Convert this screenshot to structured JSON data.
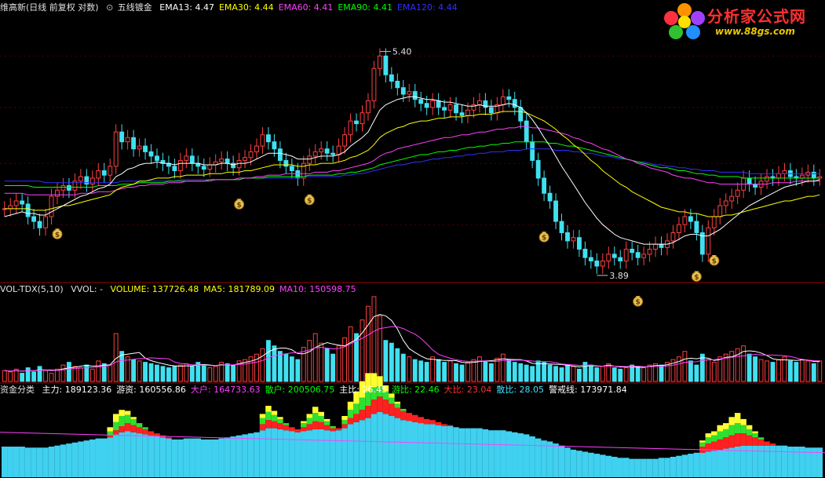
{
  "main_header": {
    "title": "维高新(日线 前复权 对数)",
    "indicator_name": "五线镀金",
    "items": [
      {
        "label": "EMA13: 4.47",
        "color": "#ffffff"
      },
      {
        "label": "EMA30: 4.44",
        "color": "#ffff00"
      },
      {
        "label": "EMA60: 4.41",
        "color": "#ff40ff"
      },
      {
        "label": "EMA90: 4.41",
        "color": "#00ff00"
      },
      {
        "label": "EMA120: 4.44",
        "color": "#3030ff"
      }
    ],
    "high_label": "5.40",
    "low_label": "3.89"
  },
  "volume_header": {
    "title": "VOL-TDX(5,10)",
    "vvol": "VVOL: -",
    "items": [
      {
        "label": "VOLUME: 137726.48",
        "color": "#ffff00"
      },
      {
        "label": "MA5: 181789.09",
        "color": "#ffff00"
      },
      {
        "label": "MA10: 150598.75",
        "color": "#ff40ff"
      }
    ]
  },
  "fund_header": {
    "title": "资金分类",
    "items": [
      {
        "label": "主力: 189123.36",
        "color": "#ffffff"
      },
      {
        "label": "游资: 160556.86",
        "color": "#ffffff"
      },
      {
        "label": "大户: 164733.63",
        "color": "#ff40ff"
      },
      {
        "label": "散户: 200506.75",
        "color": "#00ff00"
      },
      {
        "label": "主比: 26.45",
        "color": "#ffffff"
      },
      {
        "label": "游比: 22.46",
        "color": "#00ff00"
      },
      {
        "label": "大比: 23.04",
        "color": "#ff3030"
      },
      {
        "label": "散比: 28.05",
        "color": "#40e0ff"
      },
      {
        "label": "警戒线: 173971.84",
        "color": "#ffffff"
      }
    ]
  },
  "logo": {
    "title": "分析家公式网",
    "url": "www.88gs.com"
  },
  "chart_data": {
    "type": "candlestick",
    "ylim": [
      3.7,
      5.55
    ],
    "log_scale": true,
    "close": [
      4.1,
      4.12,
      4.15,
      4.13,
      4.05,
      4.02,
      3.98,
      4.05,
      4.18,
      4.22,
      4.25,
      4.22,
      4.28,
      4.31,
      4.26,
      4.3,
      4.35,
      4.32,
      4.38,
      4.62,
      4.55,
      4.58,
      4.5,
      4.52,
      4.48,
      4.45,
      4.42,
      4.4,
      4.38,
      4.35,
      4.42,
      4.45,
      4.4,
      4.38,
      4.36,
      4.39,
      4.41,
      4.43,
      4.4,
      4.37,
      4.42,
      4.44,
      4.48,
      4.52,
      4.6,
      4.55,
      4.5,
      4.42,
      4.38,
      4.35,
      4.3,
      4.4,
      4.45,
      4.48,
      4.5,
      4.47,
      4.46,
      4.52,
      4.6,
      4.7,
      4.68,
      4.76,
      4.85,
      5.1,
      5.2,
      5.05,
      5.0,
      4.95,
      4.9,
      4.92,
      4.86,
      4.83,
      4.8,
      4.85,
      4.8,
      4.78,
      4.82,
      4.76,
      4.74,
      4.78,
      4.82,
      4.85,
      4.8,
      4.76,
      4.82,
      4.88,
      4.86,
      4.8,
      4.7,
      4.55,
      4.42,
      4.3,
      4.2,
      4.15,
      4.02,
      3.95,
      3.9,
      3.92,
      3.85,
      3.8,
      3.78,
      3.75,
      3.78,
      3.82,
      3.8,
      3.78,
      3.85,
      3.83,
      3.8,
      3.82,
      3.85,
      3.88,
      3.86,
      3.9,
      3.95,
      4.0,
      4.05,
      4.02,
      3.95,
      3.82,
      3.98,
      4.05,
      4.12,
      4.15,
      4.18,
      4.22,
      4.3,
      4.26,
      4.24,
      4.28,
      4.31,
      4.3,
      4.33,
      4.35,
      4.31,
      4.3,
      4.32,
      4.34,
      4.3,
      4.31
    ],
    "ema13": [
      4.05,
      4.06,
      4.07,
      4.08,
      4.07,
      4.07,
      4.06,
      4.06,
      4.08,
      4.1,
      4.12,
      4.14,
      4.16,
      4.18,
      4.19,
      4.21,
      4.23,
      4.24,
      4.26,
      4.31,
      4.33,
      4.36,
      4.37,
      4.39,
      4.4,
      4.4,
      4.41,
      4.4,
      4.4,
      4.39,
      4.4,
      4.4,
      4.4,
      4.4,
      4.39,
      4.39,
      4.39,
      4.4,
      4.4,
      4.39,
      4.4,
      4.4,
      4.41,
      4.43,
      4.45,
      4.47,
      4.47,
      4.47,
      4.46,
      4.45,
      4.43,
      4.43,
      4.43,
      4.44,
      4.45,
      4.45,
      4.45,
      4.46,
      4.48,
      4.52,
      4.55,
      4.58,
      4.62,
      4.7,
      4.78,
      4.82,
      4.84,
      4.86,
      4.87,
      4.88,
      4.88,
      4.87,
      4.86,
      4.86,
      4.85,
      4.84,
      4.84,
      4.83,
      4.82,
      4.81,
      4.81,
      4.82,
      4.81,
      4.81,
      4.81,
      4.82,
      4.83,
      4.82,
      4.8,
      4.76,
      4.71,
      4.65,
      4.58,
      4.52,
      4.45,
      4.38,
      4.32,
      4.26,
      4.2,
      4.14,
      4.09,
      4.04,
      4.0,
      3.97,
      3.94,
      3.92,
      3.91,
      3.9,
      3.89,
      3.88,
      3.88,
      3.88,
      3.88,
      3.88,
      3.89,
      3.91,
      3.93,
      3.94,
      3.94,
      3.93,
      3.93,
      3.95,
      3.97,
      4.0,
      4.03,
      4.06,
      4.09,
      4.12,
      4.14,
      4.16,
      4.18,
      4.2,
      4.22,
      4.24,
      4.25,
      4.26,
      4.27,
      4.28,
      4.28,
      4.29
    ],
    "ema30": [
      4.1,
      4.1,
      4.1,
      4.1,
      4.1,
      4.09,
      4.09,
      4.09,
      4.1,
      4.11,
      4.12,
      4.12,
      4.13,
      4.14,
      4.15,
      4.16,
      4.17,
      4.18,
      4.19,
      4.22,
      4.24,
      4.25,
      4.26,
      4.28,
      4.28,
      4.29,
      4.3,
      4.3,
      4.3,
      4.31,
      4.31,
      4.32,
      4.32,
      4.32,
      4.32,
      4.33,
      4.33,
      4.33,
      4.34,
      4.34,
      4.34,
      4.35,
      4.35,
      4.36,
      4.37,
      4.38,
      4.39,
      4.39,
      4.39,
      4.39,
      4.38,
      4.38,
      4.39,
      4.39,
      4.4,
      4.4,
      4.4,
      4.41,
      4.42,
      4.44,
      4.45,
      4.47,
      4.49,
      4.53,
      4.58,
      4.61,
      4.63,
      4.65,
      4.66,
      4.68,
      4.69,
      4.7,
      4.7,
      4.71,
      4.72,
      4.72,
      4.73,
      4.73,
      4.73,
      4.74,
      4.74,
      4.75,
      4.75,
      4.75,
      4.76,
      4.77,
      4.77,
      4.77,
      4.77,
      4.76,
      4.74,
      4.72,
      4.7,
      4.67,
      4.64,
      4.6,
      4.57,
      4.53,
      4.5,
      4.46,
      4.42,
      4.39,
      4.35,
      4.32,
      4.29,
      4.26,
      4.24,
      4.21,
      4.19,
      4.17,
      4.15,
      4.13,
      4.11,
      4.1,
      4.09,
      4.08,
      4.08,
      4.07,
      4.07,
      4.06,
      4.05,
      4.05,
      4.05,
      4.06,
      4.06,
      4.07,
      4.08,
      4.09,
      4.1,
      4.11,
      4.12,
      4.13,
      4.14,
      4.15,
      4.15,
      4.16,
      4.17,
      4.18,
      4.18,
      4.19
    ],
    "ema60": [
      4.2,
      4.2,
      4.2,
      4.2,
      4.19,
      4.19,
      4.19,
      4.19,
      4.19,
      4.19,
      4.19,
      4.19,
      4.19,
      4.2,
      4.2,
      4.2,
      4.21,
      4.21,
      4.21,
      4.22,
      4.23,
      4.24,
      4.24,
      4.25,
      4.25,
      4.26,
      4.26,
      4.26,
      4.27,
      4.27,
      4.27,
      4.28,
      4.28,
      4.28,
      4.28,
      4.28,
      4.29,
      4.29,
      4.29,
      4.29,
      4.3,
      4.3,
      4.3,
      4.31,
      4.31,
      4.32,
      4.32,
      4.32,
      4.33,
      4.33,
      4.33,
      4.33,
      4.33,
      4.34,
      4.34,
      4.34,
      4.35,
      4.35,
      4.36,
      4.37,
      4.38,
      4.39,
      4.4,
      4.42,
      4.45,
      4.47,
      4.48,
      4.5,
      4.51,
      4.52,
      4.53,
      4.54,
      4.55,
      4.56,
      4.57,
      4.58,
      4.58,
      4.59,
      4.6,
      4.6,
      4.61,
      4.62,
      4.62,
      4.63,
      4.64,
      4.64,
      4.65,
      4.65,
      4.66,
      4.66,
      4.65,
      4.65,
      4.64,
      4.63,
      4.62,
      4.61,
      4.6,
      4.58,
      4.57,
      4.55,
      4.54,
      4.52,
      4.5,
      4.49,
      4.47,
      4.45,
      4.43,
      4.42,
      4.4,
      4.39,
      4.37,
      4.36,
      4.35,
      4.34,
      4.32,
      4.31,
      4.3,
      4.3,
      4.29,
      4.28,
      4.27,
      4.27,
      4.26,
      4.26,
      4.26,
      4.26,
      4.26,
      4.26,
      4.26,
      4.26,
      4.26,
      4.27,
      4.27,
      4.27,
      4.27,
      4.28,
      4.28,
      4.28,
      4.28,
      4.28
    ],
    "ema90": [
      4.25,
      4.25,
      4.25,
      4.25,
      4.25,
      4.24,
      4.24,
      4.24,
      4.24,
      4.24,
      4.24,
      4.24,
      4.24,
      4.24,
      4.24,
      4.24,
      4.25,
      4.25,
      4.25,
      4.25,
      4.26,
      4.26,
      4.26,
      4.27,
      4.27,
      4.27,
      4.27,
      4.27,
      4.28,
      4.28,
      4.28,
      4.28,
      4.28,
      4.28,
      4.28,
      4.29,
      4.29,
      4.29,
      4.29,
      4.29,
      4.29,
      4.3,
      4.3,
      4.3,
      4.3,
      4.31,
      4.31,
      4.31,
      4.31,
      4.31,
      4.31,
      4.31,
      4.32,
      4.32,
      4.32,
      4.32,
      4.32,
      4.33,
      4.33,
      4.34,
      4.34,
      4.35,
      4.36,
      4.37,
      4.39,
      4.4,
      4.41,
      4.42,
      4.43,
      4.44,
      4.45,
      4.46,
      4.46,
      4.47,
      4.48,
      4.48,
      4.49,
      4.49,
      4.5,
      4.51,
      4.51,
      4.52,
      4.52,
      4.53,
      4.53,
      4.54,
      4.54,
      4.55,
      4.55,
      4.55,
      4.55,
      4.55,
      4.55,
      4.54,
      4.54,
      4.53,
      4.52,
      4.52,
      4.51,
      4.5,
      4.49,
      4.48,
      4.47,
      4.46,
      4.45,
      4.44,
      4.43,
      4.42,
      4.41,
      4.4,
      4.39,
      4.38,
      4.37,
      4.37,
      4.36,
      4.35,
      4.35,
      4.34,
      4.33,
      4.33,
      4.32,
      4.32,
      4.31,
      4.31,
      4.31,
      4.31,
      4.3,
      4.3,
      4.3,
      4.3,
      4.3,
      4.3,
      4.3,
      4.3,
      4.3,
      4.3,
      4.3,
      4.3,
      4.3,
      4.3
    ],
    "ema120": [
      4.28,
      4.28,
      4.28,
      4.28,
      4.28,
      4.28,
      4.28,
      4.27,
      4.27,
      4.27,
      4.27,
      4.27,
      4.27,
      4.27,
      4.27,
      4.27,
      4.27,
      4.27,
      4.27,
      4.27,
      4.28,
      4.28,
      4.28,
      4.28,
      4.28,
      4.28,
      4.28,
      4.28,
      4.28,
      4.28,
      4.29,
      4.29,
      4.29,
      4.29,
      4.29,
      4.29,
      4.29,
      4.29,
      4.29,
      4.29,
      4.29,
      4.3,
      4.3,
      4.3,
      4.3,
      4.3,
      4.3,
      4.3,
      4.3,
      4.3,
      4.3,
      4.31,
      4.31,
      4.31,
      4.31,
      4.31,
      4.31,
      4.31,
      4.32,
      4.32,
      4.33,
      4.33,
      4.34,
      4.35,
      4.36,
      4.37,
      4.38,
      4.39,
      4.39,
      4.4,
      4.41,
      4.41,
      4.42,
      4.43,
      4.43,
      4.44,
      4.44,
      4.45,
      4.45,
      4.46,
      4.46,
      4.47,
      4.47,
      4.48,
      4.48,
      4.48,
      4.49,
      4.49,
      4.49,
      4.5,
      4.5,
      4.5,
      4.5,
      4.5,
      4.49,
      4.49,
      4.49,
      4.48,
      4.48,
      4.47,
      4.47,
      4.46,
      4.45,
      4.45,
      4.44,
      4.43,
      4.43,
      4.42,
      4.41,
      4.41,
      4.4,
      4.39,
      4.39,
      4.38,
      4.38,
      4.37,
      4.37,
      4.36,
      4.36,
      4.35,
      4.35,
      4.35,
      4.34,
      4.34,
      4.34,
      4.34,
      4.34,
      4.33,
      4.33,
      4.33,
      4.33,
      4.33,
      4.33,
      4.33,
      4.33,
      4.33,
      4.33,
      4.33,
      4.33,
      4.33
    ],
    "volume": [
      8,
      7,
      9,
      6,
      10,
      7,
      11,
      8,
      6,
      9,
      12,
      14,
      11,
      10,
      12,
      9,
      15,
      13,
      12,
      35,
      22,
      18,
      16,
      15,
      14,
      13,
      12,
      11,
      10,
      11,
      12,
      13,
      11,
      14,
      12,
      10,
      11,
      14,
      13,
      12,
      15,
      16,
      18,
      20,
      24,
      30,
      26,
      22,
      20,
      18,
      16,
      25,
      30,
      35,
      28,
      24,
      20,
      26,
      32,
      40,
      35,
      45,
      55,
      62,
      48,
      30,
      28,
      24,
      20,
      18,
      16,
      15,
      14,
      18,
      16,
      14,
      15,
      13,
      12,
      14,
      16,
      18,
      15,
      13,
      17,
      20,
      16,
      14,
      13,
      12,
      11,
      15,
      14,
      12,
      11,
      10,
      12,
      11,
      9,
      14,
      12,
      10,
      11,
      13,
      10,
      9,
      10,
      12,
      11,
      10,
      12,
      13,
      12,
      14,
      16,
      18,
      22,
      15,
      12,
      20,
      16,
      14,
      18,
      20,
      22,
      24,
      26,
      20,
      18,
      16,
      15,
      14,
      16,
      18,
      15,
      14,
      16,
      15,
      13,
      15
    ],
    "fund_cyan": [
      30,
      30,
      30,
      30,
      29,
      29,
      29,
      29,
      30,
      31,
      32,
      33,
      34,
      35,
      36,
      37,
      38,
      38,
      39,
      42,
      44,
      45,
      44,
      43,
      42,
      41,
      40,
      39,
      38,
      37,
      37,
      38,
      38,
      38,
      37,
      37,
      37,
      38,
      39,
      40,
      41,
      42,
      43,
      44,
      46,
      48,
      48,
      47,
      46,
      45,
      44,
      45,
      46,
      47,
      47,
      46,
      45,
      46,
      48,
      52,
      54,
      56,
      58,
      62,
      64,
      62,
      60,
      58,
      56,
      55,
      54,
      53,
      52,
      52,
      51,
      50,
      50,
      49,
      48,
      48,
      48,
      48,
      47,
      46,
      46,
      46,
      45,
      44,
      43,
      42,
      40,
      38,
      36,
      35,
      33,
      31,
      29,
      27,
      26,
      25,
      24,
      23,
      22,
      21,
      20,
      19,
      19,
      18,
      18,
      18,
      18,
      18,
      19,
      19,
      20,
      21,
      22,
      23,
      24,
      24,
      25,
      26,
      27,
      28,
      29,
      30,
      31,
      31,
      31,
      31,
      31,
      31,
      31,
      31,
      30,
      30,
      30,
      29,
      29,
      29
    ],
    "fund_red": [
      0,
      0,
      0,
      0,
      0,
      0,
      0,
      0,
      0,
      0,
      0,
      0,
      0,
      0,
      0,
      0,
      0,
      0,
      2,
      4,
      6,
      8,
      7,
      6,
      5,
      4,
      3,
      2,
      1,
      0,
      0,
      0,
      0,
      0,
      0,
      0,
      0,
      0,
      0,
      0,
      0,
      0,
      0,
      0,
      6,
      8,
      7,
      6,
      5,
      4,
      3,
      4,
      6,
      8,
      7,
      5,
      3,
      2,
      4,
      6,
      8,
      10,
      12,
      14,
      15,
      14,
      12,
      10,
      9,
      8,
      7,
      6,
      5,
      4,
      3,
      2,
      1,
      0,
      0,
      0,
      0,
      0,
      0,
      0,
      0,
      0,
      0,
      0,
      0,
      0,
      0,
      0,
      0,
      0,
      0,
      0,
      0,
      0,
      0,
      0,
      0,
      0,
      0,
      0,
      0,
      0,
      0,
      0,
      0,
      0,
      0,
      0,
      0,
      0,
      0,
      0,
      0,
      0,
      0,
      6,
      8,
      9,
      10,
      11,
      12,
      13,
      12,
      10,
      8,
      6,
      4,
      2,
      0,
      0,
      0,
      0,
      0,
      0,
      0,
      0
    ],
    "fund_green": [
      0,
      0,
      0,
      0,
      0,
      0,
      0,
      0,
      0,
      0,
      0,
      0,
      0,
      0,
      0,
      0,
      0,
      0,
      4,
      8,
      10,
      8,
      6,
      4,
      2,
      0,
      0,
      0,
      0,
      0,
      0,
      0,
      0,
      0,
      0,
      0,
      0,
      0,
      0,
      0,
      0,
      0,
      0,
      0,
      6,
      8,
      6,
      4,
      2,
      0,
      0,
      4,
      6,
      8,
      6,
      4,
      2,
      0,
      4,
      8,
      10,
      12,
      14,
      12,
      10,
      8,
      6,
      4,
      2,
      0,
      0,
      0,
      0,
      0,
      0,
      0,
      0,
      0,
      0,
      0,
      0,
      0,
      0,
      0,
      0,
      0,
      0,
      0,
      0,
      0,
      0,
      0,
      0,
      0,
      0,
      0,
      0,
      0,
      0,
      0,
      0,
      0,
      0,
      0,
      0,
      0,
      0,
      0,
      0,
      0,
      0,
      0,
      0,
      0,
      0,
      0,
      0,
      0,
      0,
      4,
      6,
      6,
      8,
      8,
      10,
      10,
      8,
      6,
      4,
      2,
      0,
      0,
      0,
      0,
      0,
      0,
      0,
      0,
      0,
      0
    ],
    "fund_yellow": [
      0,
      0,
      0,
      0,
      0,
      0,
      0,
      0,
      0,
      0,
      0,
      0,
      0,
      0,
      0,
      0,
      0,
      0,
      4,
      8,
      6,
      4,
      2,
      0,
      0,
      0,
      0,
      0,
      0,
      0,
      0,
      0,
      0,
      0,
      0,
      0,
      0,
      0,
      0,
      0,
      0,
      0,
      0,
      0,
      4,
      6,
      4,
      2,
      0,
      0,
      0,
      2,
      4,
      6,
      4,
      2,
      0,
      0,
      4,
      8,
      12,
      16,
      18,
      14,
      10,
      6,
      4,
      2,
      0,
      0,
      0,
      0,
      0,
      0,
      0,
      0,
      0,
      0,
      0,
      0,
      0,
      0,
      0,
      0,
      0,
      0,
      0,
      0,
      0,
      0,
      0,
      0,
      0,
      0,
      0,
      0,
      0,
      0,
      0,
      0,
      0,
      0,
      0,
      0,
      0,
      0,
      0,
      0,
      0,
      0,
      0,
      0,
      0,
      0,
      0,
      0,
      0,
      0,
      0,
      2,
      4,
      4,
      6,
      6,
      8,
      10,
      6,
      4,
      2,
      0,
      0,
      0,
      0,
      0,
      0,
      0,
      0,
      0,
      0,
      0
    ],
    "buy_signal_indices": [
      9,
      40,
      52,
      92,
      108,
      118,
      121
    ]
  }
}
